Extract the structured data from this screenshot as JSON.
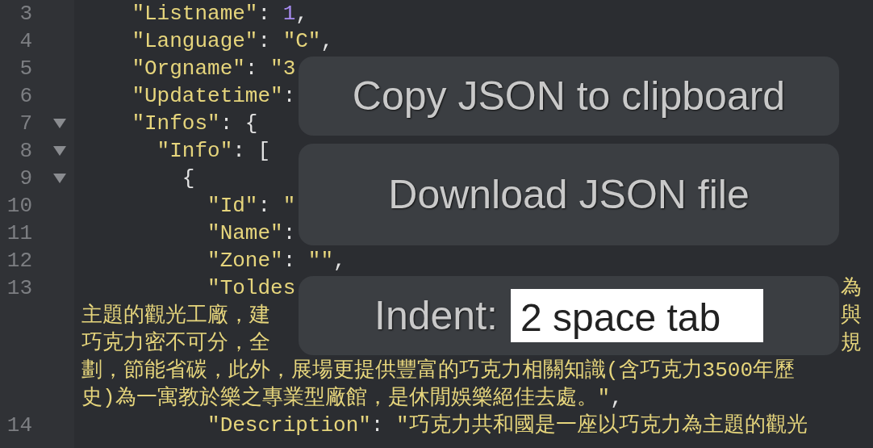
{
  "editor": {
    "rows": [
      {
        "number": "3",
        "tokens": [
          {
            "kind": "key",
            "text": "    \"Listname\""
          },
          {
            "kind": "punct",
            "text": ": "
          },
          {
            "kind": "number",
            "text": "1"
          },
          {
            "kind": "punct",
            "text": ","
          }
        ]
      },
      {
        "number": "4",
        "tokens": [
          {
            "kind": "key",
            "text": "    \"Language\""
          },
          {
            "kind": "punct",
            "text": ": "
          },
          {
            "kind": "string",
            "text": "\"C\""
          },
          {
            "kind": "punct",
            "text": ","
          }
        ]
      },
      {
        "number": "5",
        "tokens": [
          {
            "kind": "key",
            "text": "    \"Orgname\""
          },
          {
            "kind": "punct",
            "text": ": "
          },
          {
            "kind": "string",
            "text": "\"3"
          }
        ]
      },
      {
        "number": "6",
        "tokens": [
          {
            "kind": "key",
            "text": "    \"Updatetime\""
          },
          {
            "kind": "punct",
            "text": ":"
          }
        ]
      },
      {
        "number": "7",
        "expanded": true,
        "tokens": [
          {
            "kind": "key",
            "text": "    \"Infos\""
          },
          {
            "kind": "punct",
            "text": ": {"
          }
        ]
      },
      {
        "number": "8",
        "expanded": true,
        "tokens": [
          {
            "kind": "key",
            "text": "      \"Info\""
          },
          {
            "kind": "punct",
            "text": ": ["
          }
        ]
      },
      {
        "number": "9",
        "expanded": true,
        "tokens": [
          {
            "kind": "punct",
            "text": "        {"
          }
        ]
      },
      {
        "number": "10",
        "tokens": [
          {
            "kind": "key",
            "text": "          \"Id\""
          },
          {
            "kind": "punct",
            "text": ": "
          },
          {
            "kind": "string",
            "text": "\""
          }
        ]
      },
      {
        "number": "11",
        "tokens": [
          {
            "kind": "key",
            "text": "          \"Name\""
          },
          {
            "kind": "punct",
            "text": ":"
          }
        ]
      },
      {
        "number": "12",
        "tokens": [
          {
            "kind": "key",
            "text": "          \"Zone\""
          },
          {
            "kind": "punct",
            "text": ": "
          },
          {
            "kind": "string",
            "text": "\"\""
          },
          {
            "kind": "punct",
            "text": ","
          }
        ]
      },
      {
        "number": "13",
        "tokens": [
          {
            "kind": "key",
            "text": "          \"Toldes"
          }
        ],
        "right": [
          {
            "kind": "string",
            "text": "為"
          }
        ]
      },
      {
        "tokens": [
          {
            "kind": "string",
            "text": "主題的觀光工廠，建"
          }
        ],
        "right": [
          {
            "kind": "string",
            "text": "與"
          }
        ]
      },
      {
        "tokens": [
          {
            "kind": "string",
            "text": "巧克力密不可分，全"
          }
        ],
        "right": [
          {
            "kind": "string",
            "text": "規"
          }
        ]
      },
      {
        "tokens": [
          {
            "kind": "string",
            "text": "劃，節能省碳，此外，展場更提供豐富的巧克力相關知識(含巧克力3500年歷"
          }
        ]
      },
      {
        "tokens": [
          {
            "kind": "string",
            "text": "史)為一寓教於樂之專業型廠館，是休閒娛樂絕佳去處。\""
          },
          {
            "kind": "punct",
            "text": ","
          }
        ]
      },
      {
        "number": "14",
        "tokens": [
          {
            "kind": "key",
            "text": "          \"Description\""
          },
          {
            "kind": "punct",
            "text": ": "
          },
          {
            "kind": "string",
            "text": "\"巧克力共和國是一座以巧克力為主題的觀光"
          }
        ]
      }
    ]
  },
  "overlay": {
    "copy_button": "Copy JSON to clipboard",
    "download_button": "Download JSON file",
    "indent": {
      "label": "Indent:",
      "value": "2 space tab"
    }
  }
}
